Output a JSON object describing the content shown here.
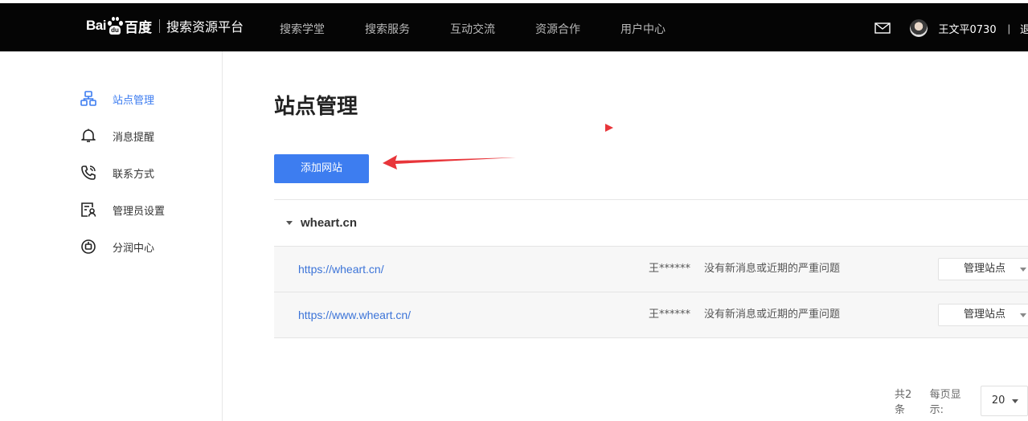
{
  "header": {
    "logo_latin": "Bai",
    "logo_du": "du",
    "logo_cn": "百度",
    "platform": "搜索资源平台",
    "nav": [
      "搜索学堂",
      "搜索服务",
      "互动交流",
      "资源合作",
      "用户中心"
    ],
    "username": "王文平0730",
    "divider": "|",
    "logout": "退出",
    "icons": {
      "mail": "mail-icon",
      "avatar": "user-avatar"
    }
  },
  "sidebar": {
    "items": [
      {
        "label": "站点管理",
        "icon": "site-manage-icon",
        "active": true
      },
      {
        "label": "消息提醒",
        "icon": "bell-icon",
        "active": false
      },
      {
        "label": "联系方式",
        "icon": "phone-icon",
        "active": false
      },
      {
        "label": "管理员设置",
        "icon": "admin-settings-icon",
        "active": false
      },
      {
        "label": "分润中心",
        "icon": "revenue-share-icon",
        "active": false
      }
    ]
  },
  "main": {
    "title": "站点管理",
    "add_button": "添加网站",
    "group": {
      "name": "wheart.cn"
    },
    "rows": [
      {
        "url": "https://wheart.cn/",
        "owner": "王******",
        "status": "没有新消息或近期的严重问题",
        "action": "管理站点"
      },
      {
        "url": "https://www.wheart.cn/",
        "owner": "王******",
        "status": "没有新消息或近期的严重问题",
        "action": "管理站点"
      }
    ],
    "pager": {
      "total": "共2条",
      "per_page_label": "每页显示:",
      "per_page_value": "20"
    }
  },
  "colors": {
    "accent": "#3d7df0",
    "link": "#3c74d8",
    "annotation": "#e8353a",
    "topbar": "#050505"
  }
}
